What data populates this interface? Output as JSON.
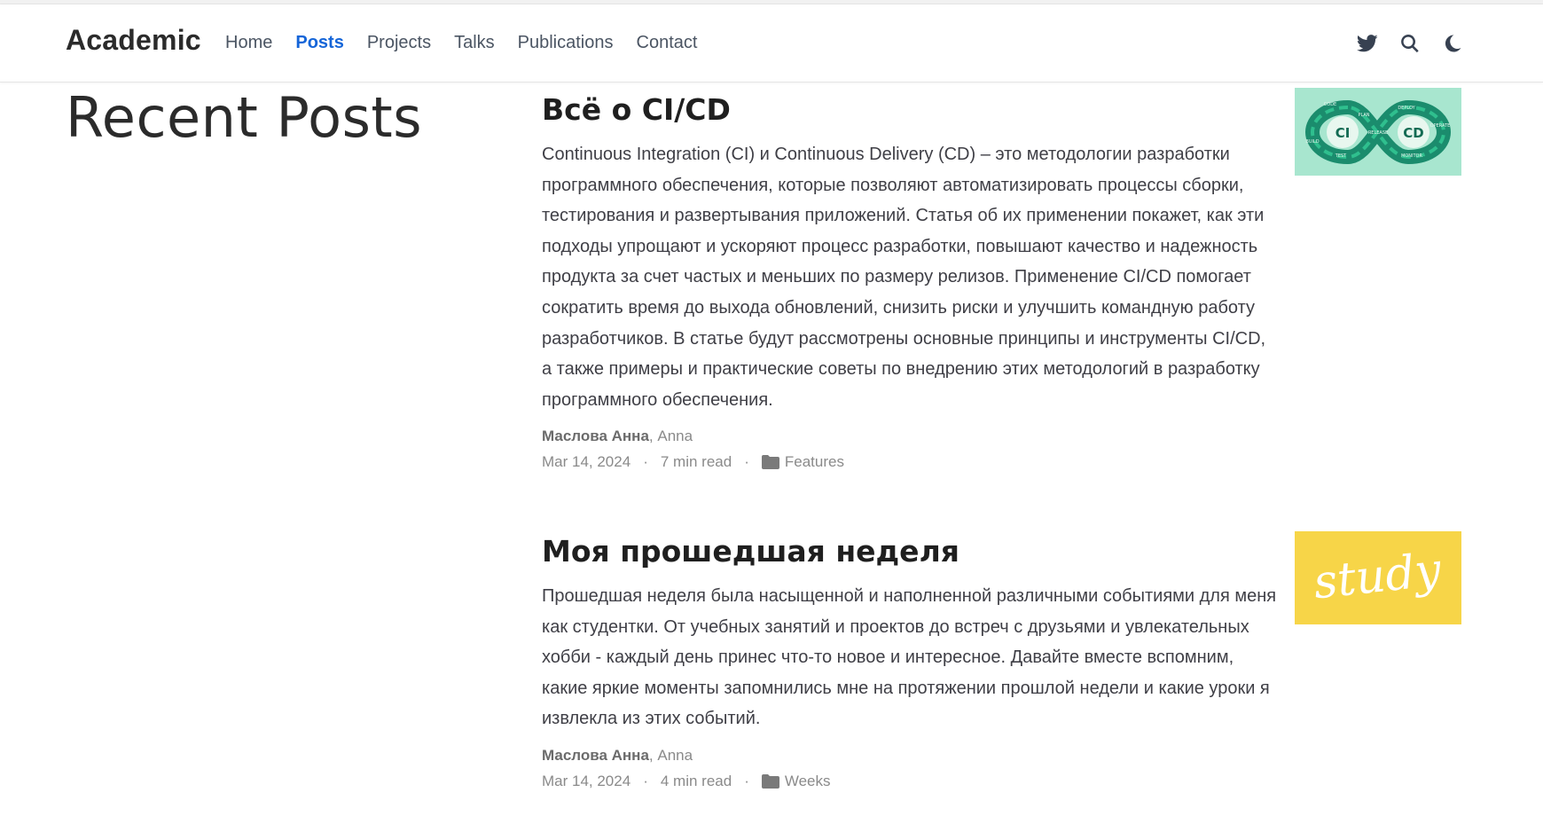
{
  "nav": {
    "brand": "Academic",
    "links": [
      {
        "label": "Home"
      },
      {
        "label": "Posts"
      },
      {
        "label": "Projects"
      },
      {
        "label": "Talks"
      },
      {
        "label": "Publications"
      },
      {
        "label": "Contact"
      }
    ],
    "active_index": 1,
    "icons": [
      "twitter-icon",
      "search-icon",
      "moon-icon"
    ]
  },
  "page": {
    "title": "Recent Posts"
  },
  "posts": [
    {
      "title": "Всё о CI/CD",
      "summary": "Continuous Integration (CI) и Continuous Delivery (CD) – это методологии разработки программного обеспечения, которые позволяют автоматизировать процессы сборки, тестирования и развертывания приложений. Статья об их применении покажет, как эти подходы упрощают и ускоряют процесс разработки, повышают качество и надежность продукта за счет частых и меньших по размеру релизов. Применение CI/CD помогает сократить время до выхода обновлений, снизить риски и улучшить командную работу разработчиков. В статье будут рассмотрены основные принципы и инструменты CI/CD, а также примеры и практические советы по внедрению этих методологий в разработку программного обеспечения.",
      "author_primary": "Маслова Анна",
      "author_secondary": ", Anna",
      "date": "Mar 14, 2024",
      "read_time": "7 min read",
      "category": "Features",
      "thumb_labels": {
        "left": "CI",
        "right": "CD",
        "steps": [
          "CODE",
          "PLAN",
          "BUILD",
          "TEST",
          "RELEASE",
          "DEPLOY",
          "OPERATE",
          "MONITOR"
        ]
      },
      "thumb_color": "#a8e6cf"
    },
    {
      "title": "Моя прошедшая неделя",
      "summary": "Прошедшая неделя была насыщенной и наполненной различными событиями для меня как студентки. От учебных занятий и проектов до встреч с друзьями и увлекательных хобби - каждый день принес что-то новое и интересное. Давайте вместе вспомним, какие яркие моменты запомнились мне на протяжении прошлой недели и какие уроки я извлекла из этих событий.",
      "author_primary": "Маслова Анна",
      "author_secondary": ", Anna",
      "date": "Mar 14, 2024",
      "read_time": "4 min read",
      "category": "Weeks",
      "thumb_text": "study",
      "thumb_color": "#f7d548"
    }
  ],
  "meta_separator": "·",
  "colors": {
    "accent": "#1565d8",
    "text": "#3f3f46",
    "muted": "#8a8a8a"
  }
}
